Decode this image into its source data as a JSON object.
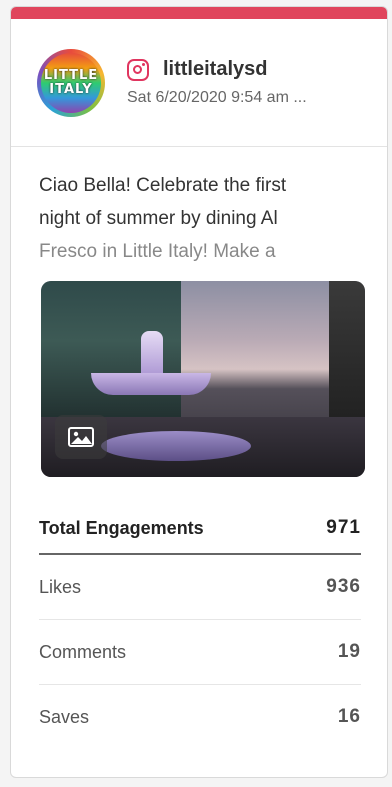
{
  "post": {
    "handle": "littleitalysd",
    "timestamp": "Sat 6/20/2020 9:54 am ...",
    "avatar_text_line1": "LITTLE",
    "avatar_text_line2": "ITALY",
    "caption_line1": "Ciao Bella! Celebrate the first",
    "caption_line2": "night of summer by dining Al",
    "caption_line3": "Fresco in Little Italy! Make a",
    "network_icon": "instagram-icon",
    "photo_icon": "image-icon"
  },
  "stats": {
    "total_label": "Total Engagements",
    "total_value": "971",
    "rows": [
      {
        "label": "Likes",
        "value": "936"
      },
      {
        "label": "Comments",
        "value": "19"
      },
      {
        "label": "Saves",
        "value": "16"
      }
    ]
  },
  "colors": {
    "accent": "#e0455c",
    "instagram": "#e0355f"
  }
}
